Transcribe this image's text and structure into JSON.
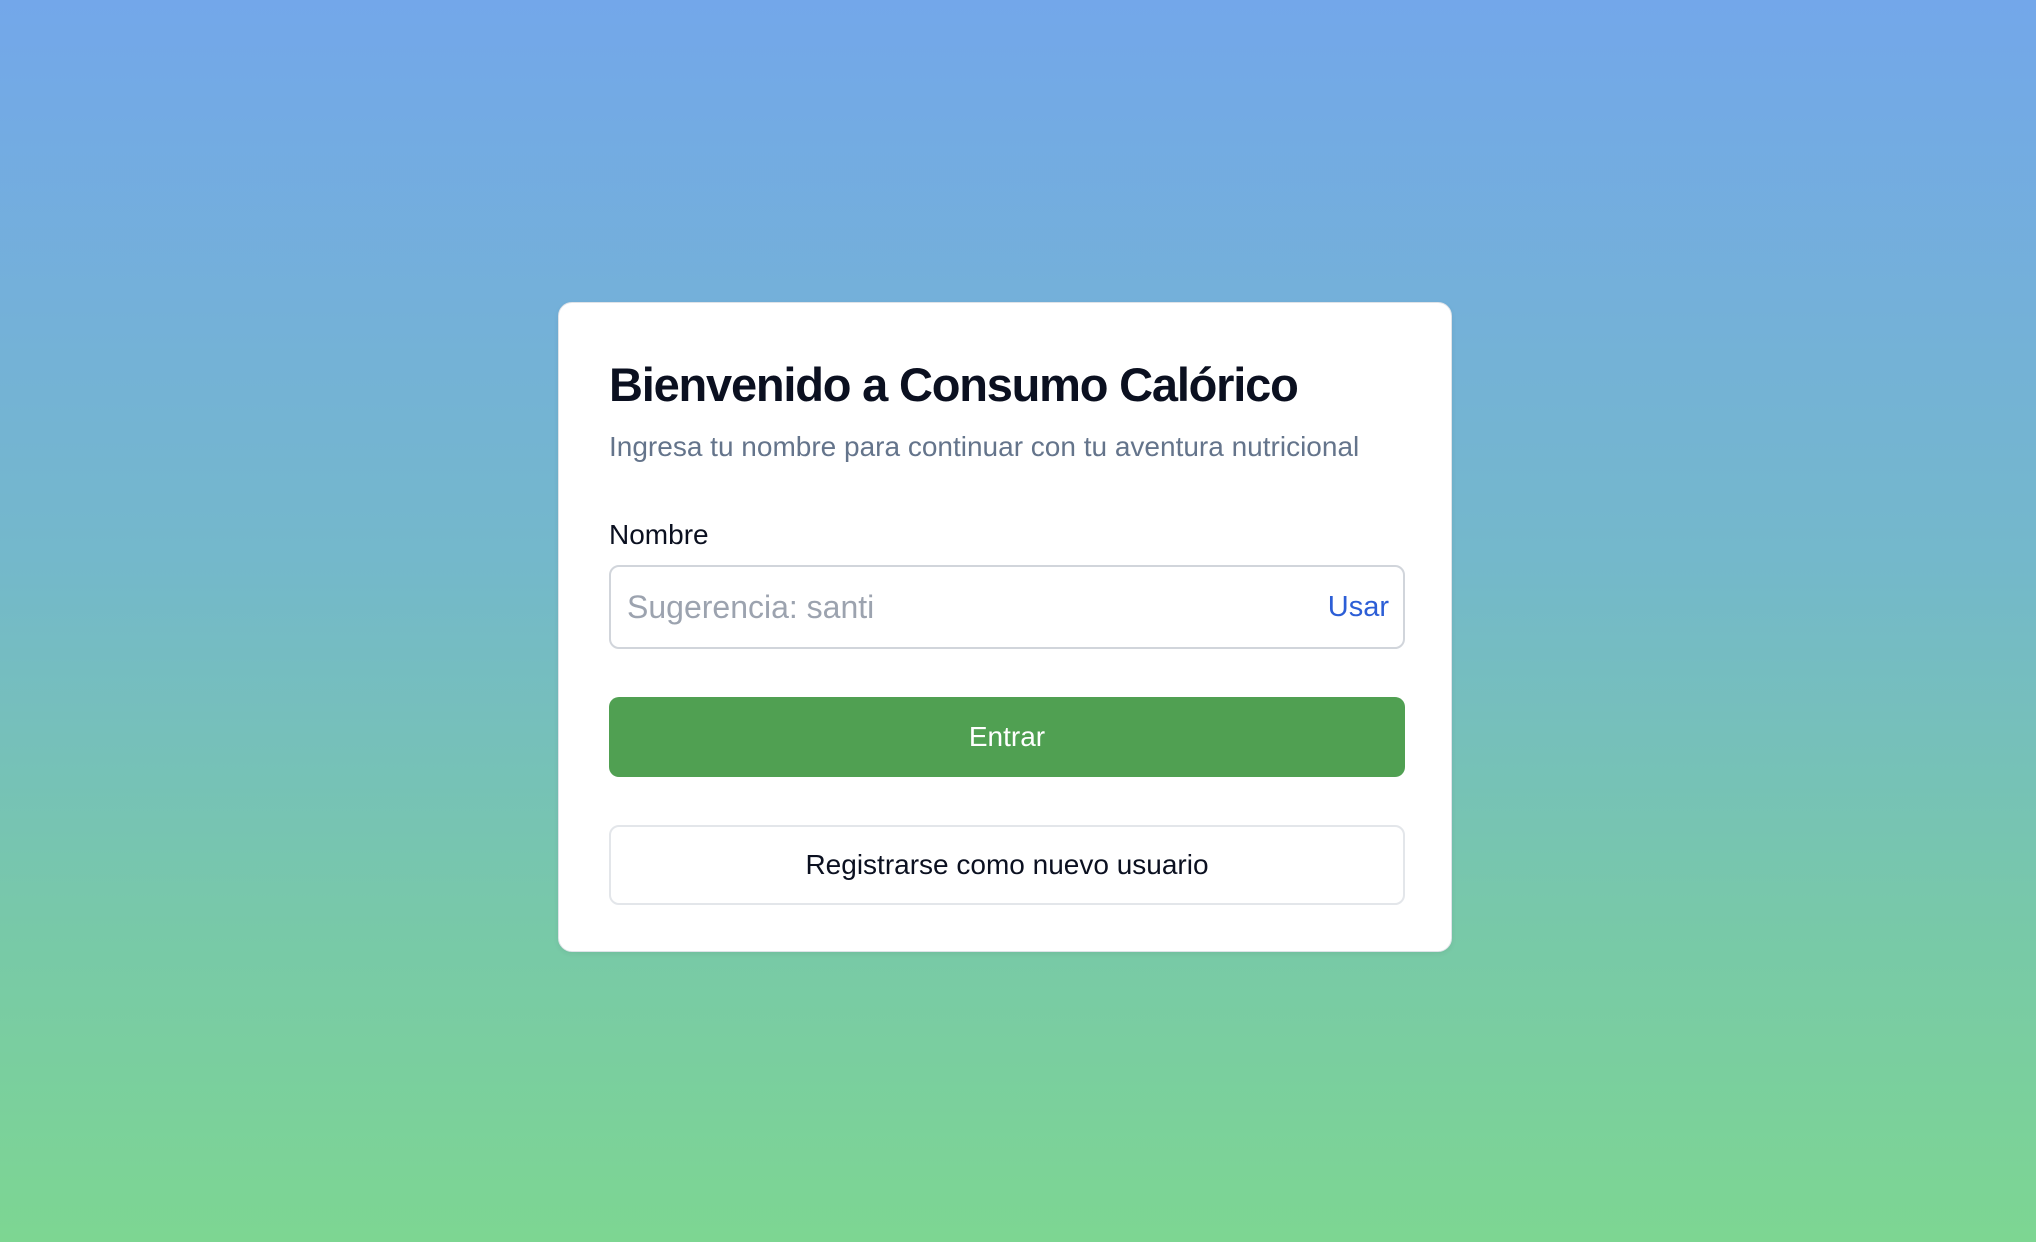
{
  "login": {
    "title": "Bienvenido a Consumo Calórico",
    "subtitle": "Ingresa tu nombre para continuar con tu aventura nutricional",
    "name_label": "Nombre",
    "name_value": "",
    "name_placeholder": "Sugerencia: santi",
    "use_suggestion_label": "Usar",
    "enter_label": "Entrar",
    "register_label": "Registrarse como nuevo usuario"
  },
  "colors": {
    "primary_button": "#50a052",
    "link": "#2c5ed6",
    "gradient_top": "#73a7ea",
    "gradient_bottom": "#7dd692"
  }
}
